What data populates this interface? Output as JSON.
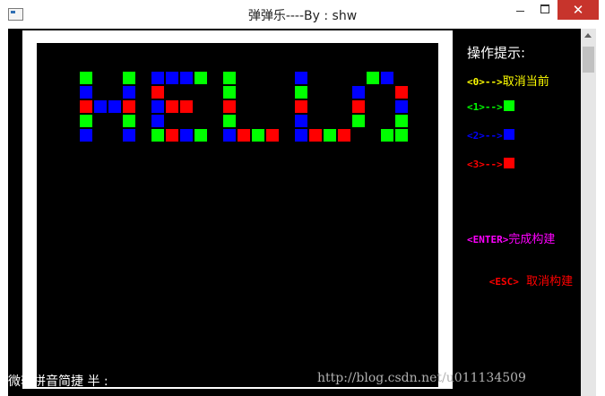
{
  "window": {
    "title": "弹弹乐----By : shw",
    "close_glyph": "✕"
  },
  "hints": {
    "heading": "操作提示:",
    "items": [
      {
        "code": "<0>-->",
        "label": "取消当前",
        "color": "#ffff00",
        "swatch": ""
      },
      {
        "code": "<1>-->",
        "label": "",
        "color": "#00ff00",
        "swatch": "#00ff00"
      },
      {
        "code": "<2>-->",
        "label": "",
        "color": "#0000ff",
        "swatch": "#0000ff"
      },
      {
        "code": "<3>-->",
        "label": "",
        "color": "#ff0000",
        "swatch": "#ff0000"
      },
      {
        "code": "<ENTER>",
        "label": "完成构建",
        "color": "#ff00ff",
        "swatch": ""
      },
      {
        "code": "<ESC>",
        "label": "  取消构建",
        "color": "#ff0000",
        "swatch": ""
      }
    ]
  },
  "board_colors": {
    "G": "#00ff00",
    "B": "#0000ff",
    "R": "#ff0000"
  },
  "board_rows": [
    "G..G.BBBG.G....B....GB",
    "B..B.R....G....G...B..R",
    "RBBR.BRR..R....R...R..B",
    "G..G.B....G....B...G..G",
    "B..B.GRBG.BRGR.BRGR..GG"
  ],
  "status_line": "微软拼音简捷 半 :",
  "watermark": "http://blog.csdn.net/u011134509"
}
